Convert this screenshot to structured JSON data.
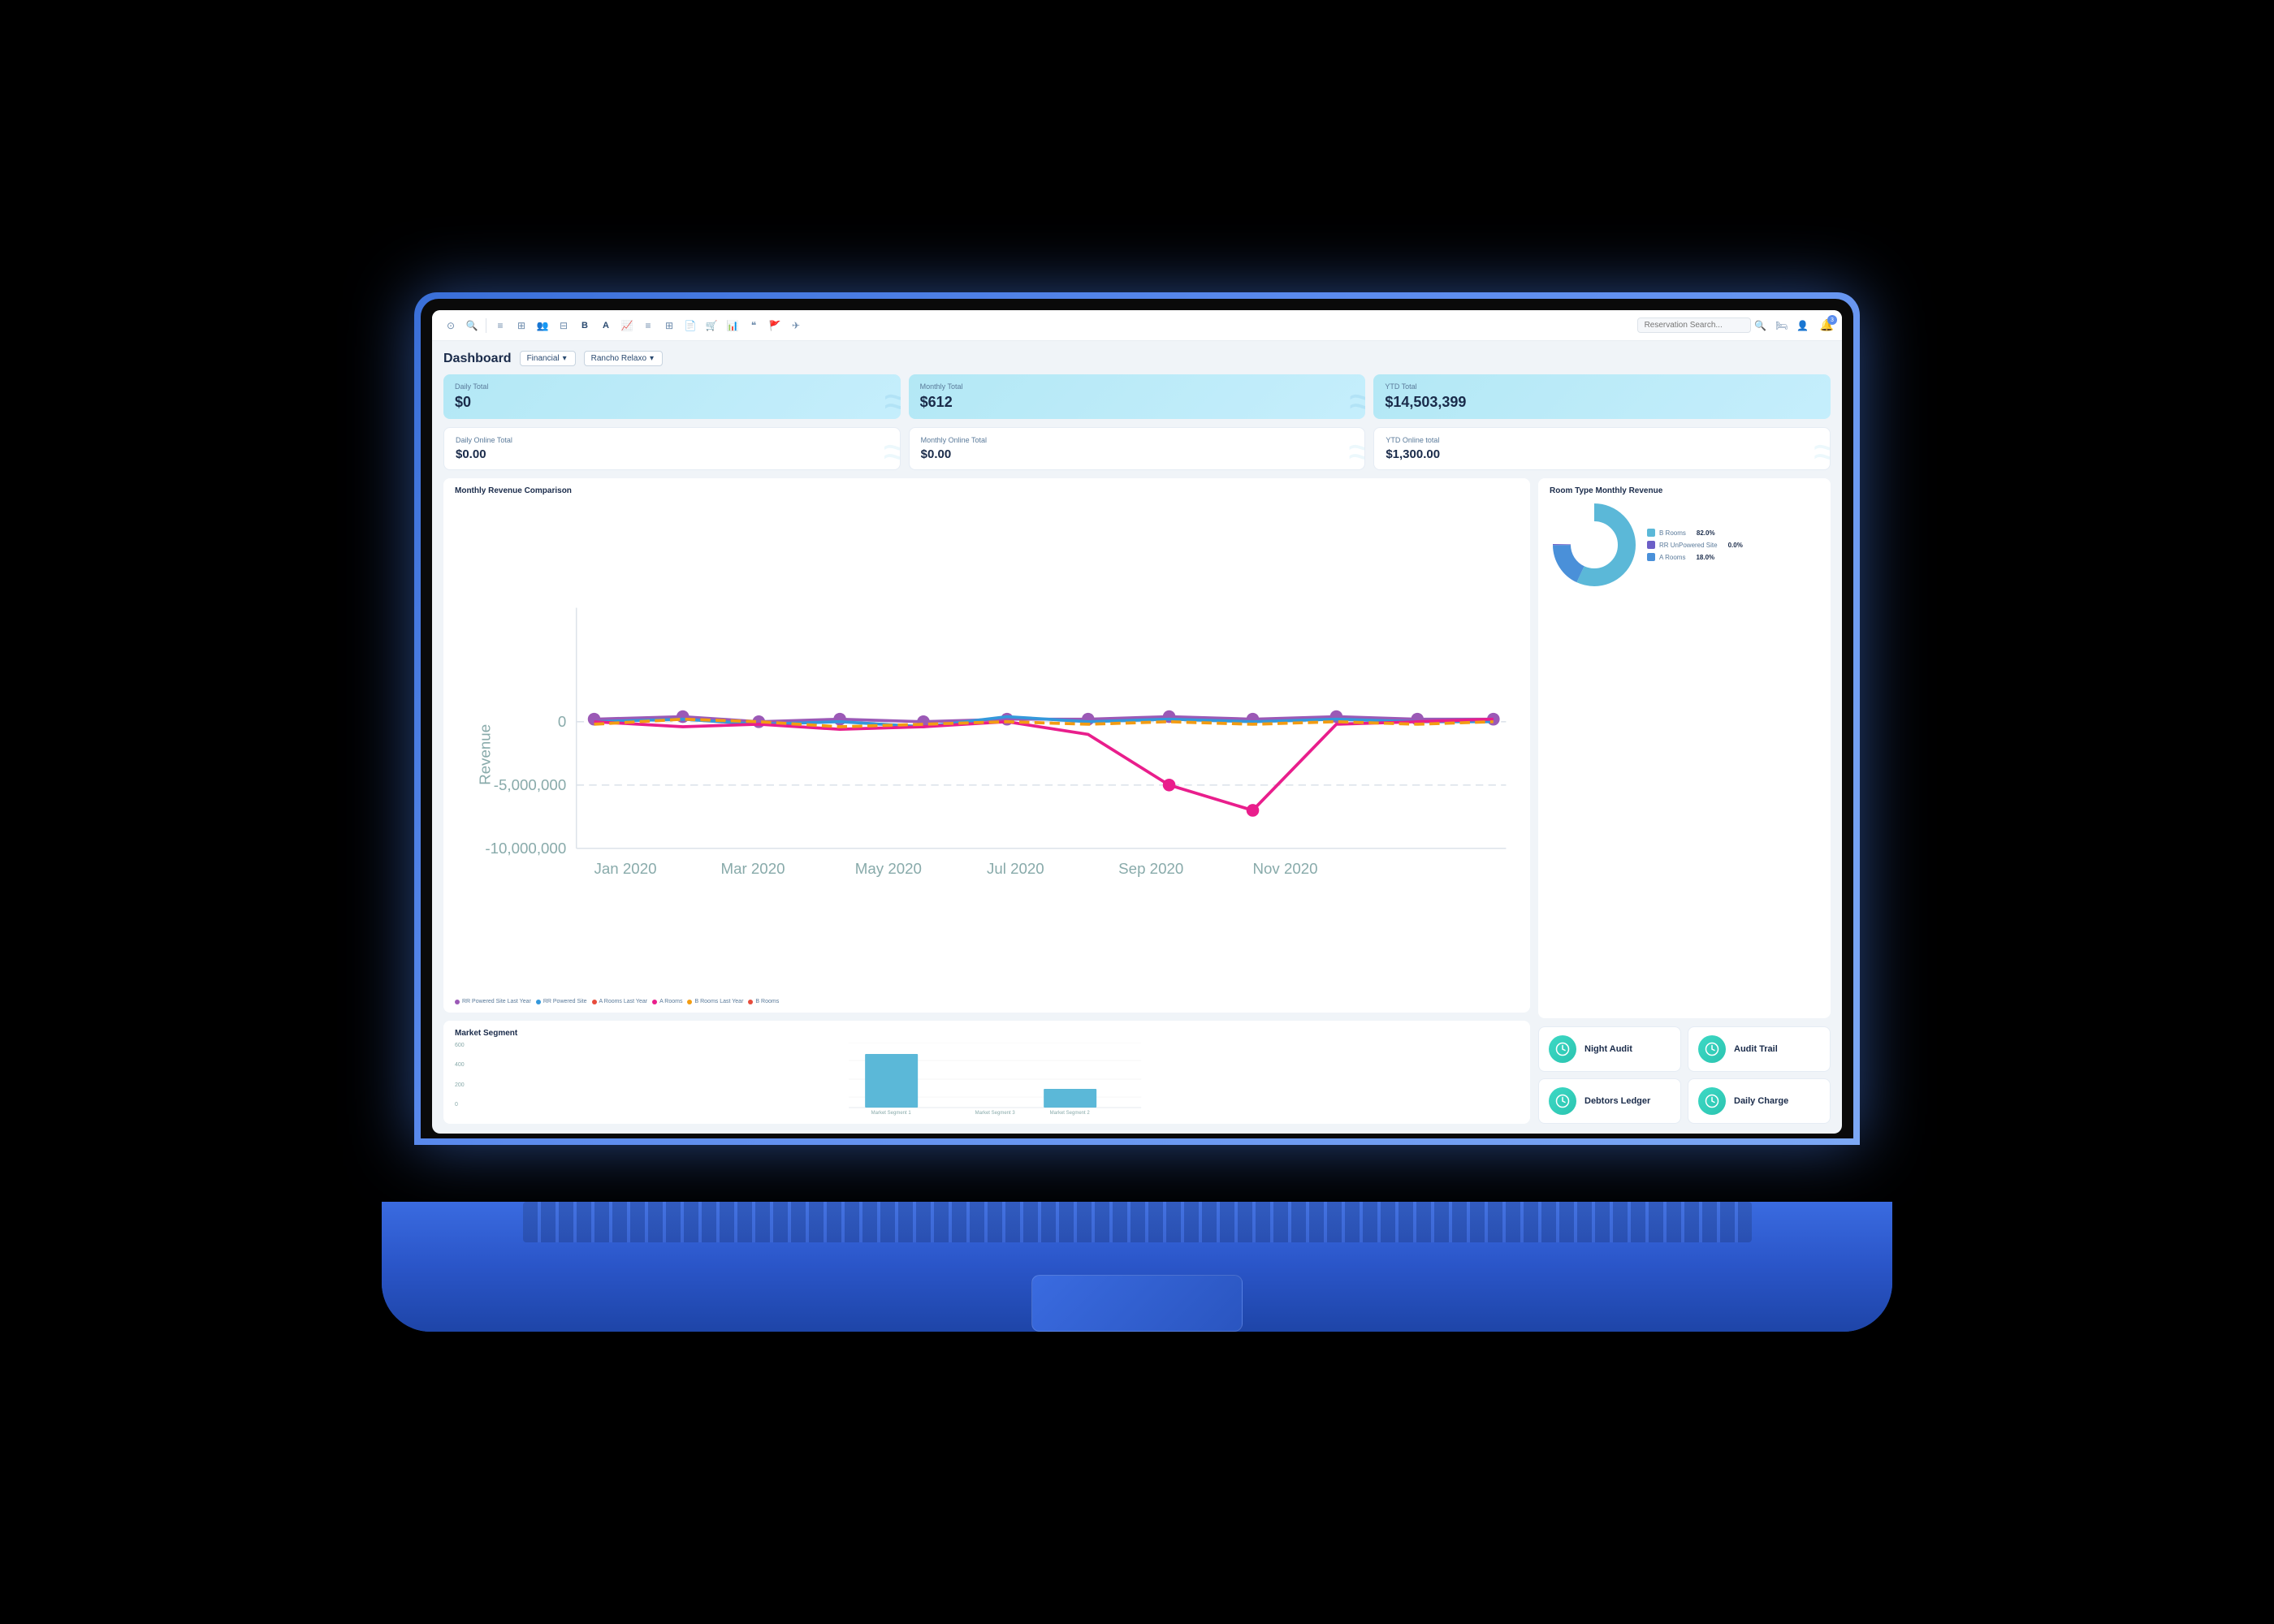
{
  "app": {
    "title": "Dashboard",
    "navbar": {
      "search_placeholder": "Reservation Search...",
      "bell_badge": "3",
      "icons": [
        "⊙",
        "🔍",
        "≡",
        "⊞",
        "👥",
        "⊟",
        "B",
        "A",
        "📈",
        "≡",
        "⊞",
        "📄",
        "🛒",
        "📊",
        "❝",
        "🚩",
        "✈"
      ]
    },
    "dropdowns": {
      "type": "Financial",
      "property": "Rancho Relaxo"
    },
    "stats": {
      "daily_total_label": "Daily Total",
      "daily_total_value": "$0",
      "monthly_total_label": "Monthly Total",
      "monthly_total_value": "$612",
      "ytd_total_label": "YTD Total",
      "ytd_total_value": "$14,503,399",
      "daily_online_label": "Daily Online Total",
      "daily_online_value": "$0.00",
      "monthly_online_label": "Monthly Online Total",
      "monthly_online_value": "$0.00",
      "ytd_online_label": "YTD Online total",
      "ytd_online_value": "$1,300.00"
    },
    "monthly_revenue": {
      "title": "Monthly Revenue Comparison",
      "x_labels": [
        "Jan 2020",
        "Mar 2020",
        "May 2020",
        "Jul 2020",
        "Sep 2020",
        "Nov 2020"
      ],
      "y_labels": [
        "0",
        "-5,000,000",
        "-10,000,000"
      ],
      "legend": [
        {
          "label": "RR Powered Site Last Year",
          "color": "#9b59b6"
        },
        {
          "label": "RR Powered Site",
          "color": "#3498db"
        },
        {
          "label": "A Rooms Last Year",
          "color": "#e74c3c"
        },
        {
          "label": "A Rooms",
          "color": "#e91e8c"
        },
        {
          "label": "B Rooms Last Year",
          "color": "#f39c12"
        },
        {
          "label": "B Rooms",
          "color": "#e74c3c"
        }
      ]
    },
    "room_type_revenue": {
      "title": "Room Type Monthly Revenue",
      "segments": [
        {
          "label": "B Rooms",
          "pct": "82.0%",
          "color": "#5bb8d8",
          "value": 82
        },
        {
          "label": "RR UnPowered Site",
          "pct": "0.0%",
          "color": "#6c5fc7",
          "value": 0
        },
        {
          "label": "A Rooms",
          "pct": "18.0%",
          "color": "#4a90d9",
          "value": 18
        }
      ]
    },
    "market_segment": {
      "title": "Market Segment",
      "y_labels": [
        "600",
        "400",
        "200",
        "0"
      ],
      "bars": [
        {
          "label": "Market Segment 1",
          "height": 70,
          "color": "#5bb8d8"
        },
        {
          "label": "Market Segment 3",
          "height": 0,
          "color": "#5bb8d8"
        },
        {
          "label": "Market Segment 2",
          "height": 25,
          "color": "#5bb8d8"
        }
      ]
    },
    "actions": [
      {
        "label": "Night Audit",
        "icon": "🕐"
      },
      {
        "label": "Audit Trail",
        "icon": "🕐"
      },
      {
        "label": "Debtors Ledger",
        "icon": "🕐"
      },
      {
        "label": "Daily Charge",
        "icon": "🕐"
      }
    ]
  }
}
